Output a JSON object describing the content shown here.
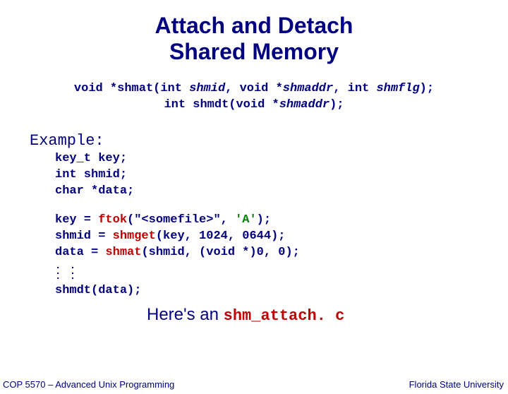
{
  "title_l1": "Attach and Detach",
  "title_l2": "Shared Memory",
  "proto1_pre": "void *shmat(int ",
  "proto1_p1": "shmid",
  "proto1_mid1": ", void *",
  "proto1_p2": "shmaddr",
  "proto1_mid2": ", int ",
  "proto1_p3": "shmflg",
  "proto1_post": ");",
  "proto2_pre": "int shmdt(void *",
  "proto2_p1": "shmaddr",
  "proto2_post": ");",
  "example_label": "Example:",
  "decl1": "key_t key;",
  "decl2": "int shmid;",
  "decl3": "char *data;",
  "l1a": "key = ",
  "l1b": "ftok",
  "l1c": "(\"<somefile>\", ",
  "l1d": "'A'",
  "l1e": ");",
  "l2a": "shmid = ",
  "l2b": "shmget",
  "l2c": "(key, 1024, 0644);",
  "l3a": "data = ",
  "l3b": "shmat",
  "l3c": "(shmid, (void *)0, 0);",
  "l4": "shmdt(data);",
  "link_pre": "Here's an ",
  "link_fn": "shm_attach. c",
  "footer_left": "COP 5570 – Advanced Unix Programming",
  "footer_right": "Florida State University"
}
